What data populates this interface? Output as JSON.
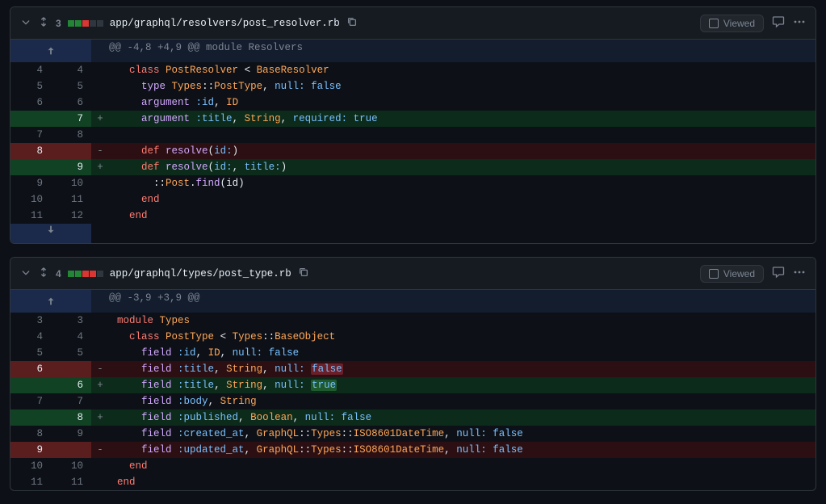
{
  "files": [
    {
      "change_count": "3",
      "diffstat": [
        "add",
        "add",
        "del",
        "neutral",
        "neutral"
      ],
      "path": "app/graphql/resolvers/post_resolver.rb",
      "viewed_label": "Viewed",
      "hunk_header": "@@ -4,8 +4,9 @@ module Resolvers",
      "has_expand_down": true,
      "rows": [
        {
          "t": "ctx",
          "ol": "4",
          "nl": "4",
          "mk": " ",
          "seg": [
            {
              "c": "tok-p",
              "x": "  "
            },
            {
              "c": "tok-kw",
              "x": "class"
            },
            {
              "c": "tok-p",
              "x": " "
            },
            {
              "c": "tok-cls",
              "x": "PostResolver"
            },
            {
              "c": "tok-p",
              "x": " < "
            },
            {
              "c": "tok-cls",
              "x": "BaseResolver"
            }
          ]
        },
        {
          "t": "ctx",
          "ol": "5",
          "nl": "5",
          "mk": " ",
          "seg": [
            {
              "c": "tok-p",
              "x": "    "
            },
            {
              "c": "tok-fn",
              "x": "type"
            },
            {
              "c": "tok-p",
              "x": " "
            },
            {
              "c": "tok-cls",
              "x": "Types"
            },
            {
              "c": "tok-p",
              "x": "::"
            },
            {
              "c": "tok-cls",
              "x": "PostType"
            },
            {
              "c": "tok-p",
              "x": ", "
            },
            {
              "c": "tok-sym",
              "x": "null:"
            },
            {
              "c": "tok-p",
              "x": " "
            },
            {
              "c": "tok-const",
              "x": "false"
            }
          ]
        },
        {
          "t": "ctx",
          "ol": "6",
          "nl": "6",
          "mk": " ",
          "seg": [
            {
              "c": "tok-p",
              "x": "    "
            },
            {
              "c": "tok-fn",
              "x": "argument"
            },
            {
              "c": "tok-p",
              "x": " "
            },
            {
              "c": "tok-sym",
              "x": ":id"
            },
            {
              "c": "tok-p",
              "x": ", "
            },
            {
              "c": "tok-cls",
              "x": "ID"
            }
          ]
        },
        {
          "t": "add",
          "ol": "",
          "nl": "7",
          "mk": "+",
          "seg": [
            {
              "c": "tok-p",
              "x": "    "
            },
            {
              "c": "tok-fn",
              "x": "argument"
            },
            {
              "c": "tok-p",
              "x": " "
            },
            {
              "c": "tok-sym",
              "x": ":title"
            },
            {
              "c": "tok-p",
              "x": ", "
            },
            {
              "c": "tok-cls",
              "x": "String"
            },
            {
              "c": "tok-p",
              "x": ", "
            },
            {
              "c": "tok-sym",
              "x": "required:"
            },
            {
              "c": "tok-p",
              "x": " "
            },
            {
              "c": "tok-const",
              "x": "true"
            }
          ]
        },
        {
          "t": "ctx",
          "ol": "7",
          "nl": "8",
          "mk": " ",
          "seg": [
            {
              "c": "tok-p",
              "x": ""
            }
          ]
        },
        {
          "t": "del",
          "ol": "8",
          "nl": "",
          "mk": "-",
          "seg": [
            {
              "c": "tok-p",
              "x": "    "
            },
            {
              "c": "tok-kw",
              "x": "def"
            },
            {
              "c": "tok-p",
              "x": " "
            },
            {
              "c": "tok-fn",
              "x": "resolve"
            },
            {
              "c": "tok-p",
              "x": "("
            },
            {
              "c": "tok-sym",
              "x": "id:"
            },
            {
              "c": "tok-p",
              "x": ")"
            }
          ]
        },
        {
          "t": "add",
          "ol": "",
          "nl": "9",
          "mk": "+",
          "seg": [
            {
              "c": "tok-p",
              "x": "    "
            },
            {
              "c": "tok-kw",
              "x": "def"
            },
            {
              "c": "tok-p",
              "x": " "
            },
            {
              "c": "tok-fn",
              "x": "resolve"
            },
            {
              "c": "tok-p",
              "x": "("
            },
            {
              "c": "tok-sym",
              "x": "id:"
            },
            {
              "c": "tok-p",
              "x": ", "
            },
            {
              "c": "tok-sym",
              "x": "title:"
            },
            {
              "c": "tok-p",
              "x": ")"
            }
          ]
        },
        {
          "t": "ctx",
          "ol": "9",
          "nl": "10",
          "mk": " ",
          "seg": [
            {
              "c": "tok-p",
              "x": "      ::"
            },
            {
              "c": "tok-cls",
              "x": "Post"
            },
            {
              "c": "tok-p",
              "x": "."
            },
            {
              "c": "tok-fn",
              "x": "find"
            },
            {
              "c": "tok-p",
              "x": "("
            },
            {
              "c": "tok-p",
              "x": "id"
            },
            {
              "c": "tok-p",
              "x": ")"
            }
          ]
        },
        {
          "t": "ctx",
          "ol": "10",
          "nl": "11",
          "mk": " ",
          "seg": [
            {
              "c": "tok-p",
              "x": "    "
            },
            {
              "c": "tok-kw",
              "x": "end"
            }
          ]
        },
        {
          "t": "ctx",
          "ol": "11",
          "nl": "12",
          "mk": " ",
          "seg": [
            {
              "c": "tok-p",
              "x": "  "
            },
            {
              "c": "tok-kw",
              "x": "end"
            }
          ]
        }
      ]
    },
    {
      "change_count": "4",
      "diffstat": [
        "add",
        "add",
        "del",
        "del",
        "neutral"
      ],
      "path": "app/graphql/types/post_type.rb",
      "viewed_label": "Viewed",
      "hunk_header": "@@ -3,9 +3,9 @@",
      "has_expand_down": false,
      "rows": [
        {
          "t": "ctx",
          "ol": "3",
          "nl": "3",
          "mk": " ",
          "seg": [
            {
              "c": "tok-kw",
              "x": "module"
            },
            {
              "c": "tok-p",
              "x": " "
            },
            {
              "c": "tok-cls",
              "x": "Types"
            }
          ]
        },
        {
          "t": "ctx",
          "ol": "4",
          "nl": "4",
          "mk": " ",
          "seg": [
            {
              "c": "tok-p",
              "x": "  "
            },
            {
              "c": "tok-kw",
              "x": "class"
            },
            {
              "c": "tok-p",
              "x": " "
            },
            {
              "c": "tok-cls",
              "x": "PostType"
            },
            {
              "c": "tok-p",
              "x": " < "
            },
            {
              "c": "tok-cls",
              "x": "Types"
            },
            {
              "c": "tok-p",
              "x": "::"
            },
            {
              "c": "tok-cls",
              "x": "BaseObject"
            }
          ]
        },
        {
          "t": "ctx",
          "ol": "5",
          "nl": "5",
          "mk": " ",
          "seg": [
            {
              "c": "tok-p",
              "x": "    "
            },
            {
              "c": "tok-fn",
              "x": "field"
            },
            {
              "c": "tok-p",
              "x": " "
            },
            {
              "c": "tok-sym",
              "x": ":id"
            },
            {
              "c": "tok-p",
              "x": ", "
            },
            {
              "c": "tok-cls",
              "x": "ID"
            },
            {
              "c": "tok-p",
              "x": ", "
            },
            {
              "c": "tok-sym",
              "x": "null:"
            },
            {
              "c": "tok-p",
              "x": " "
            },
            {
              "c": "tok-const",
              "x": "false"
            }
          ]
        },
        {
          "t": "del",
          "ol": "6",
          "nl": "",
          "mk": "-",
          "seg": [
            {
              "c": "tok-p",
              "x": "    "
            },
            {
              "c": "tok-fn",
              "x": "field"
            },
            {
              "c": "tok-p",
              "x": " "
            },
            {
              "c": "tok-sym",
              "x": ":title"
            },
            {
              "c": "tok-p",
              "x": ", "
            },
            {
              "c": "tok-cls",
              "x": "String"
            },
            {
              "c": "tok-p",
              "x": ", "
            },
            {
              "c": "tok-sym",
              "x": "null:"
            },
            {
              "c": "tok-p",
              "x": " "
            },
            {
              "c": "hl-del tok-const",
              "x": "false"
            }
          ]
        },
        {
          "t": "add",
          "ol": "",
          "nl": "6",
          "mk": "+",
          "seg": [
            {
              "c": "tok-p",
              "x": "    "
            },
            {
              "c": "tok-fn",
              "x": "field"
            },
            {
              "c": "tok-p",
              "x": " "
            },
            {
              "c": "tok-sym",
              "x": ":title"
            },
            {
              "c": "tok-p",
              "x": ", "
            },
            {
              "c": "tok-cls",
              "x": "String"
            },
            {
              "c": "tok-p",
              "x": ", "
            },
            {
              "c": "tok-sym",
              "x": "null:"
            },
            {
              "c": "tok-p",
              "x": " "
            },
            {
              "c": "hl-add tok-const",
              "x": "true"
            }
          ]
        },
        {
          "t": "ctx",
          "ol": "7",
          "nl": "7",
          "mk": " ",
          "seg": [
            {
              "c": "tok-p",
              "x": "    "
            },
            {
              "c": "tok-fn",
              "x": "field"
            },
            {
              "c": "tok-p",
              "x": " "
            },
            {
              "c": "tok-sym",
              "x": ":body"
            },
            {
              "c": "tok-p",
              "x": ", "
            },
            {
              "c": "tok-cls",
              "x": "String"
            }
          ]
        },
        {
          "t": "add",
          "ol": "",
          "nl": "8",
          "mk": "+",
          "seg": [
            {
              "c": "tok-p",
              "x": "    "
            },
            {
              "c": "tok-fn",
              "x": "field"
            },
            {
              "c": "tok-p",
              "x": " "
            },
            {
              "c": "tok-sym",
              "x": ":published"
            },
            {
              "c": "tok-p",
              "x": ", "
            },
            {
              "c": "tok-cls",
              "x": "Boolean"
            },
            {
              "c": "tok-p",
              "x": ", "
            },
            {
              "c": "tok-sym",
              "x": "null:"
            },
            {
              "c": "tok-p",
              "x": " "
            },
            {
              "c": "tok-const",
              "x": "false"
            }
          ]
        },
        {
          "t": "ctx",
          "ol": "8",
          "nl": "9",
          "mk": " ",
          "seg": [
            {
              "c": "tok-p",
              "x": "    "
            },
            {
              "c": "tok-fn",
              "x": "field"
            },
            {
              "c": "tok-p",
              "x": " "
            },
            {
              "c": "tok-sym",
              "x": ":created_at"
            },
            {
              "c": "tok-p",
              "x": ", "
            },
            {
              "c": "tok-cls",
              "x": "GraphQL"
            },
            {
              "c": "tok-p",
              "x": "::"
            },
            {
              "c": "tok-cls",
              "x": "Types"
            },
            {
              "c": "tok-p",
              "x": "::"
            },
            {
              "c": "tok-cls",
              "x": "ISO8601DateTime"
            },
            {
              "c": "tok-p",
              "x": ", "
            },
            {
              "c": "tok-sym",
              "x": "null:"
            },
            {
              "c": "tok-p",
              "x": " "
            },
            {
              "c": "tok-const",
              "x": "false"
            }
          ]
        },
        {
          "t": "del",
          "ol": "9",
          "nl": "",
          "mk": "-",
          "seg": [
            {
              "c": "tok-p",
              "x": "    "
            },
            {
              "c": "tok-fn",
              "x": "field"
            },
            {
              "c": "tok-p",
              "x": " "
            },
            {
              "c": "tok-sym",
              "x": ":updated_at"
            },
            {
              "c": "tok-p",
              "x": ", "
            },
            {
              "c": "tok-cls",
              "x": "GraphQL"
            },
            {
              "c": "tok-p",
              "x": "::"
            },
            {
              "c": "tok-cls",
              "x": "Types"
            },
            {
              "c": "tok-p",
              "x": "::"
            },
            {
              "c": "tok-cls",
              "x": "ISO8601DateTime"
            },
            {
              "c": "tok-p",
              "x": ", "
            },
            {
              "c": "tok-sym",
              "x": "null:"
            },
            {
              "c": "tok-p",
              "x": " "
            },
            {
              "c": "tok-const",
              "x": "false"
            }
          ]
        },
        {
          "t": "ctx",
          "ol": "10",
          "nl": "10",
          "mk": " ",
          "seg": [
            {
              "c": "tok-p",
              "x": "  "
            },
            {
              "c": "tok-kw",
              "x": "end"
            }
          ]
        },
        {
          "t": "ctx",
          "ol": "11",
          "nl": "11",
          "mk": " ",
          "seg": [
            {
              "c": "tok-kw",
              "x": "end"
            }
          ]
        }
      ]
    }
  ]
}
